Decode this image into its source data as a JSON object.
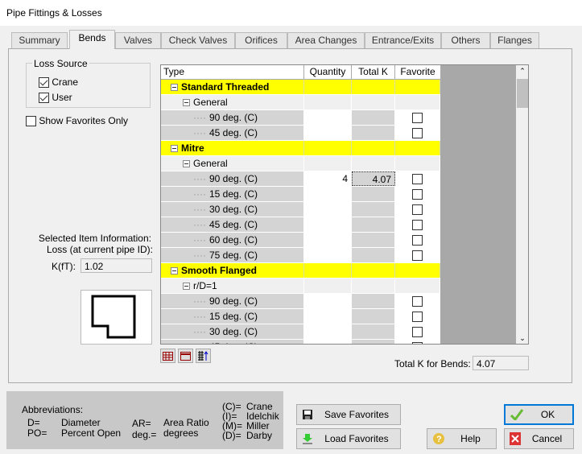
{
  "window": {
    "title": "Pipe Fittings & Losses"
  },
  "tabs": [
    {
      "label": "Summary"
    },
    {
      "label": "Bends",
      "active": true
    },
    {
      "label": "Valves"
    },
    {
      "label": "Check Valves"
    },
    {
      "label": "Orifices"
    },
    {
      "label": "Area Changes"
    },
    {
      "label": "Entrance/Exits"
    },
    {
      "label": "Others"
    },
    {
      "label": "Flanges"
    }
  ],
  "loss_source": {
    "title": "Loss Source",
    "crane": {
      "label": "Crane",
      "checked": true
    },
    "user": {
      "label": "User",
      "checked": true
    }
  },
  "show_favorites": {
    "label": "Show Favorites Only",
    "checked": false
  },
  "selected_info": {
    "line1": "Selected Item Information:",
    "line2": "Loss (at current pipe ID):",
    "kft_label": "K(fT):",
    "kft_value": "1.02"
  },
  "grid": {
    "headers": {
      "type": "Type",
      "quantity": "Quantity",
      "total_k": "Total K",
      "favorite": "Favorite"
    },
    "rows": [
      {
        "kind": "category",
        "label": "Standard Threaded"
      },
      {
        "kind": "group",
        "label": "General"
      },
      {
        "kind": "item",
        "label": "90 deg. (C)",
        "quantity": "",
        "total_k": "",
        "favorite": false
      },
      {
        "kind": "item",
        "label": "45 deg. (C)",
        "quantity": "",
        "total_k": "",
        "favorite": false
      },
      {
        "kind": "category",
        "label": "Mitre"
      },
      {
        "kind": "group",
        "label": "General"
      },
      {
        "kind": "item",
        "label": "90 deg. (C)",
        "quantity": "4",
        "total_k": "4.07",
        "favorite": false
      },
      {
        "kind": "item",
        "label": "15 deg. (C)",
        "quantity": "",
        "total_k": "",
        "favorite": false
      },
      {
        "kind": "item",
        "label": "30 deg. (C)",
        "quantity": "",
        "total_k": "",
        "favorite": false
      },
      {
        "kind": "item",
        "label": "45 deg. (C)",
        "quantity": "",
        "total_k": "",
        "favorite": false
      },
      {
        "kind": "item",
        "label": "60 deg. (C)",
        "quantity": "",
        "total_k": "",
        "favorite": false
      },
      {
        "kind": "item",
        "label": "75 deg. (C)",
        "quantity": "",
        "total_k": "",
        "favorite": false
      },
      {
        "kind": "category",
        "label": "Smooth Flanged"
      },
      {
        "kind": "group",
        "label": "r/D=1"
      },
      {
        "kind": "item",
        "label": "90 deg. (C)",
        "quantity": "",
        "total_k": "",
        "favorite": false
      },
      {
        "kind": "item",
        "label": "15 deg. (C)",
        "quantity": "",
        "total_k": "",
        "favorite": false
      },
      {
        "kind": "item",
        "label": "30 deg. (C)",
        "quantity": "",
        "total_k": "",
        "favorite": false
      },
      {
        "kind": "item",
        "label": "45 deg. (C)",
        "quantity": "",
        "total_k": "",
        "favorite": false
      }
    ]
  },
  "total": {
    "label": "Total K for Bends:",
    "value": "4.07"
  },
  "abbreviations": {
    "title": "Abbreviations:",
    "items": [
      {
        "k": "D=",
        "v": "Diameter"
      },
      {
        "k": "PO=",
        "v": "Percent Open"
      },
      {
        "k": "AR=",
        "v": "Area Ratio"
      },
      {
        "k": "deg.=",
        "v": "degrees"
      }
    ],
    "sources": [
      {
        "k": "(C)=",
        "v": "Crane"
      },
      {
        "k": "(I)=",
        "v": "Idelchik"
      },
      {
        "k": "(M)=",
        "v": "Miller"
      },
      {
        "k": "(D)=",
        "v": "Darby"
      }
    ]
  },
  "buttons": {
    "save": "Save Favorites",
    "load": "Load Favorites",
    "help": "Help",
    "ok": "OK",
    "cancel": "Cancel"
  },
  "colors": {
    "category_highlight": "#ffff00",
    "ok_border": "#0078d7"
  }
}
